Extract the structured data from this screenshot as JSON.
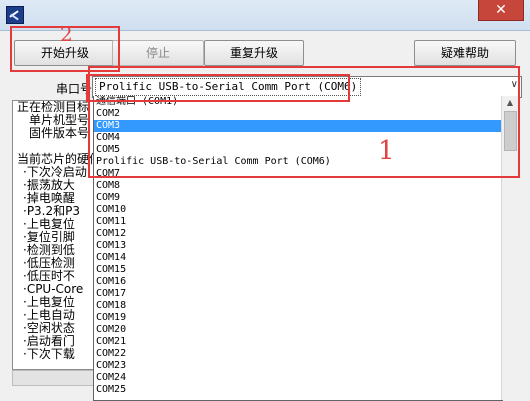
{
  "toolbar": {
    "start_label": "开始升级",
    "stop_label": "停止",
    "reupgrade_label": "重复升级",
    "help_label": "疑难帮助"
  },
  "port": {
    "label": "串口号",
    "selected": "Prolific USB-to-Serial Comm Port (COM6)"
  },
  "info_panel": {
    "lines": [
      "正在检测目标",
      "单片机型号",
      "固件版本号",
      "当前芯片的硬件",
      "·下次冷启动",
      "·振荡放大",
      "·掉电唤醒",
      "·P3.2和P3",
      "·上电复位",
      "·复位引脚",
      "·检测到低",
      "·低压检测",
      "·低压时不",
      "·CPU-Core",
      "·上电复位",
      "·上电自动",
      "·空闲状态",
      "·启动看门",
      "·下次下载"
    ]
  },
  "dropdown": {
    "items": [
      "通信端口 (COM1)",
      "COM2",
      "COM3",
      "COM4",
      "COM5",
      "Prolific USB-to-Serial Comm Port (COM6)",
      "COM7",
      "COM8",
      "COM9",
      "COM10",
      "COM11",
      "COM12",
      "COM13",
      "COM14",
      "COM15",
      "COM16",
      "COM17",
      "COM18",
      "COM19",
      "COM20",
      "COM21",
      "COM22",
      "COM23",
      "COM24",
      "COM25"
    ],
    "highlighted": "COM3"
  },
  "annotations": {
    "box1_number": "1",
    "box2_number": "2"
  },
  "colors": {
    "annotation": "#e53a3a",
    "selection": "#3399ff",
    "close_button": "#c7463b"
  },
  "icons": {
    "app": "programmer-app-icon",
    "close": "close-icon",
    "dropdown_arrow": "chevron-down-icon"
  }
}
